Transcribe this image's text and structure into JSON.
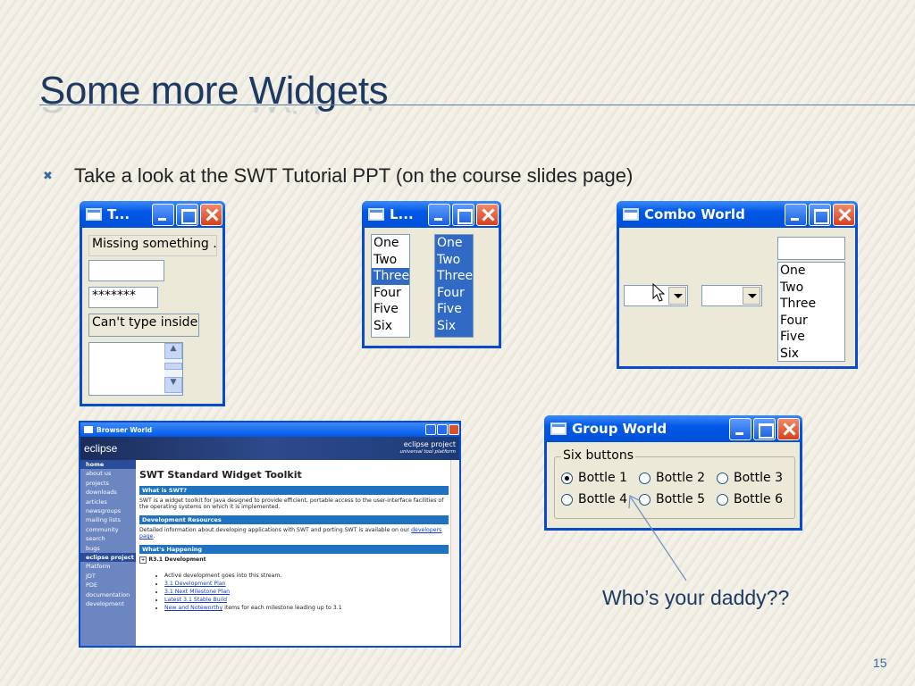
{
  "slide": {
    "title": "Some more Widgets",
    "bullet": "Take a look at the SWT Tutorial PPT (on the course slides page)",
    "caption": "Who’s your daddy??",
    "page_number": "15"
  },
  "text_window": {
    "title": "T...",
    "fields": [
      "Missing something ...",
      "",
      "*******",
      "Can't type inside",
      ""
    ]
  },
  "list_window": {
    "title": "L...",
    "list1": [
      "One",
      "Two",
      "Three",
      "Four",
      "Five",
      "Six"
    ],
    "list2": [
      "One",
      "Two",
      "Three",
      "Four",
      "Five",
      "Six"
    ]
  },
  "combo_window": {
    "title": "Combo World",
    "items": [
      "One",
      "Two",
      "Three",
      "Four",
      "Five",
      "Six"
    ]
  },
  "group_window": {
    "title": "Group World",
    "group_label": "Six buttons",
    "radios": [
      "Bottle 1",
      "Bottle 2",
      "Bottle 3",
      "Bottle 4",
      "Bottle 5",
      "Bottle 6"
    ]
  },
  "browser_window": {
    "title": "Browser World",
    "logo": "eclipse",
    "project": "eclipse project",
    "tagline": "universal tool platform",
    "nav1": [
      "home",
      "about us",
      "projects",
      "downloads",
      "articles",
      "newsgroups",
      "mailing lists",
      "community",
      "search",
      "bugs"
    ],
    "nav_header": "eclipse project",
    "nav2": [
      "Platform",
      "JDT",
      "PDE",
      "documentation",
      "development"
    ],
    "heading": "SWT Standard Widget Toolkit",
    "sec1": "What is SWT?",
    "sec1_text": "SWT is a widget toolkit for Java designed to provide efficient, portable access to the user-interface facilities of the operating systems on which it is implemented.",
    "sec2": "Development Resources",
    "sec2_text": "Detailed information about developing applications with SWT and porting SWT is available on our",
    "sec2_link": "developers page",
    "sec3": "What's Happening",
    "sub": "R3.1 Development",
    "items": [
      "Active development goes into this stream.",
      "3.1 Development Plan",
      "3.1 Next Milestone Plan",
      "Latest 3.1 Stable Build",
      "New and Noteworthy"
    ],
    "items_tail": "items for each milestone leading up to 3.1"
  }
}
